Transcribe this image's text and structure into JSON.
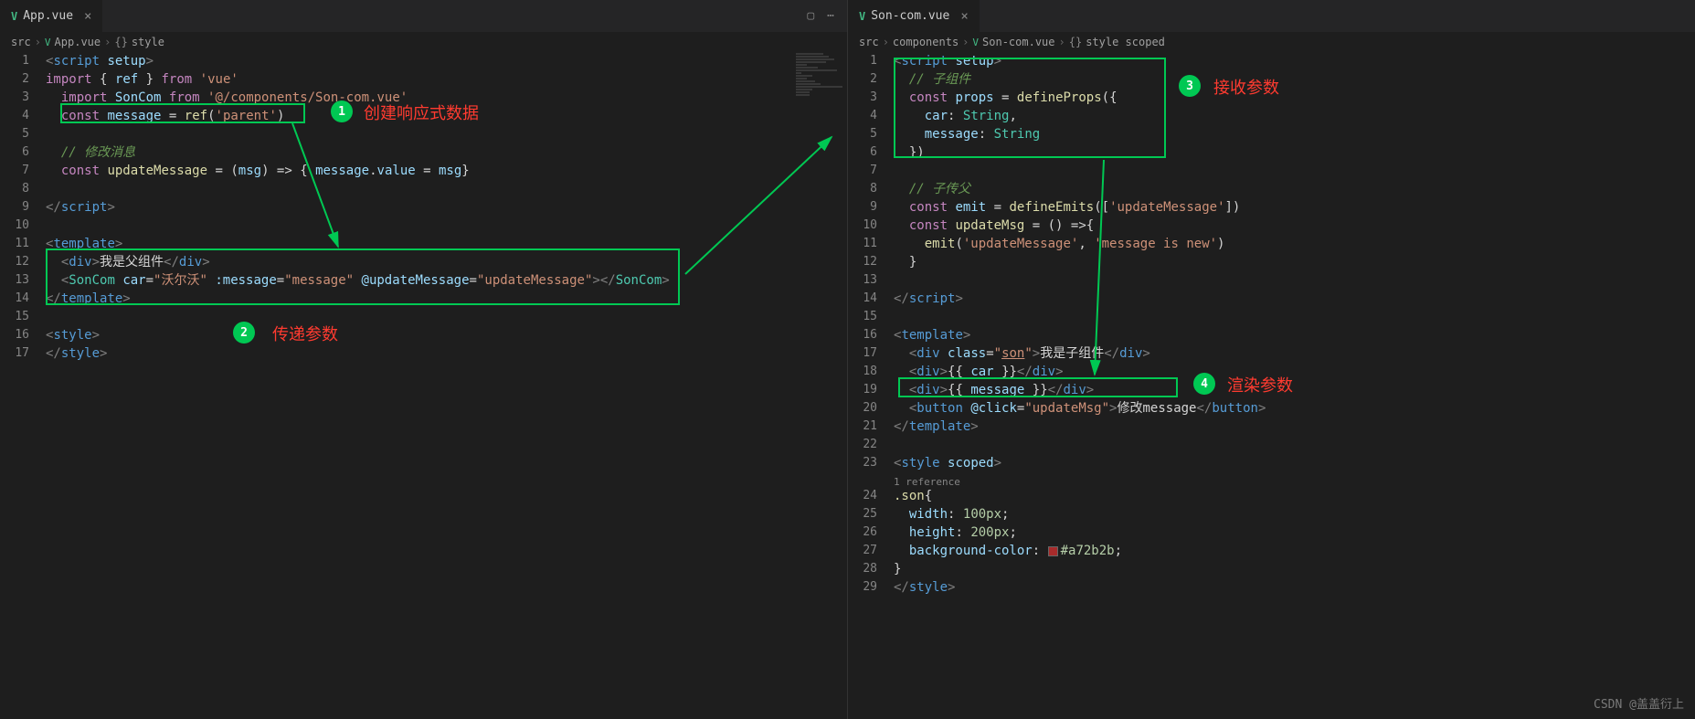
{
  "left": {
    "tab": {
      "icon": "V",
      "name": "App.vue"
    },
    "breadcrumb": [
      "src",
      "App.vue",
      "style"
    ],
    "lines": [
      "<script setup>",
      "import { ref } from 'vue'",
      "  import SonCom from '@/components/Son-com.vue'",
      "  const message = ref('parent')",
      "",
      "  // 修改消息",
      "  const updateMessage = (msg) => { message.value = msg}",
      "",
      "</script>",
      "",
      "<template>",
      "  <div>我是父组件</div>",
      "  <SonCom car=\"沃尔沃\" :message=\"message\" @updateMessage=\"updateMessage\"></SonCom>",
      "</template>",
      "",
      "<style>",
      "</style>"
    ]
  },
  "right": {
    "tab": {
      "icon": "V",
      "name": "Son-com.vue"
    },
    "breadcrumb": [
      "src",
      "components",
      "Son-com.vue",
      "style scoped"
    ],
    "lines": [
      "<script setup>",
      "  // 子组件",
      "  const props = defineProps({",
      "    car: String,",
      "    message: String",
      "  })",
      "",
      "  // 子传父",
      "  const emit = defineEmits(['updateMessage'])",
      "  const updateMsg = () =>{",
      "    emit('updateMessage', 'message is new')",
      "  }",
      "",
      "</script>",
      "",
      "<template>",
      "  <div class=\"son\">我是子组件</div>",
      "  <div>{{ car }}</div>",
      "  <div>{{ message }}</div>",
      "  <button @click=\"updateMsg\">修改message</button>",
      "</template>",
      "",
      "<style scoped>",
      "1 reference",
      ".son{",
      "  width: 100px;",
      "  height: 200px;",
      "  background-color: #a72b2b;",
      "}",
      "</style>"
    ]
  },
  "annotations": {
    "b1": "1",
    "t1": "创建响应式数据",
    "b2": "2",
    "t2": "传递参数",
    "b3": "3",
    "t3": "接收参数",
    "b4": "4",
    "t4": "渲染参数"
  },
  "watermark": "CSDN @盖盖衍上"
}
